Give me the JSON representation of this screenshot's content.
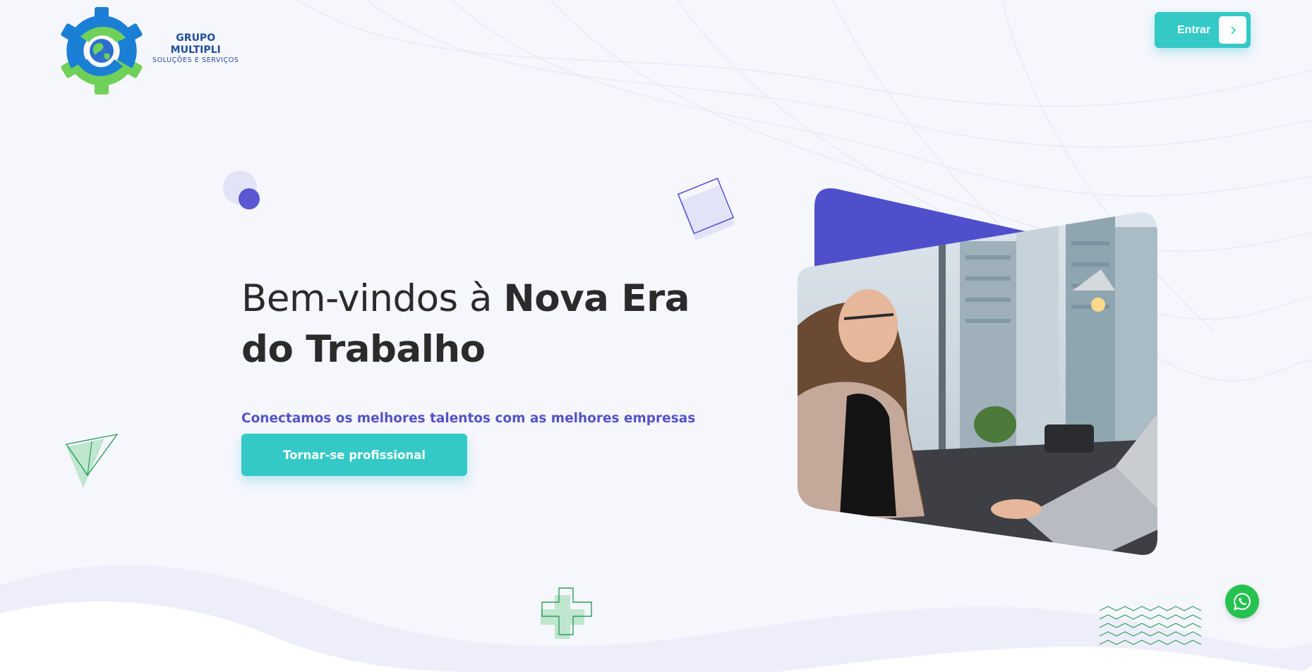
{
  "brand": {
    "line1": "GRUPO",
    "line2": "MULTIPLI",
    "tagline": "SOLUÇÕES E SERVIÇOS"
  },
  "header": {
    "login_label": "Entrar",
    "login_icon": "chevron-right-icon"
  },
  "hero": {
    "title_light": "Bem-vindos à ",
    "title_bold_1": "Nova Era",
    "title_bold_2": "do Trabalho",
    "subtitle": "Conectamos os melhores talentos com as melhores empresas",
    "cta_label": "Tornar-se profissional",
    "image_icon": "office-woman-photo"
  },
  "floating": {
    "whatsapp_icon": "whatsapp-icon"
  },
  "colors": {
    "accent": "#34c9c7",
    "primary": "#4f4fcc",
    "subtitle": "#5453c8",
    "heading": "#2b2b2b",
    "green_deco": "#2e9e5b",
    "whatsapp": "#25c24f"
  }
}
